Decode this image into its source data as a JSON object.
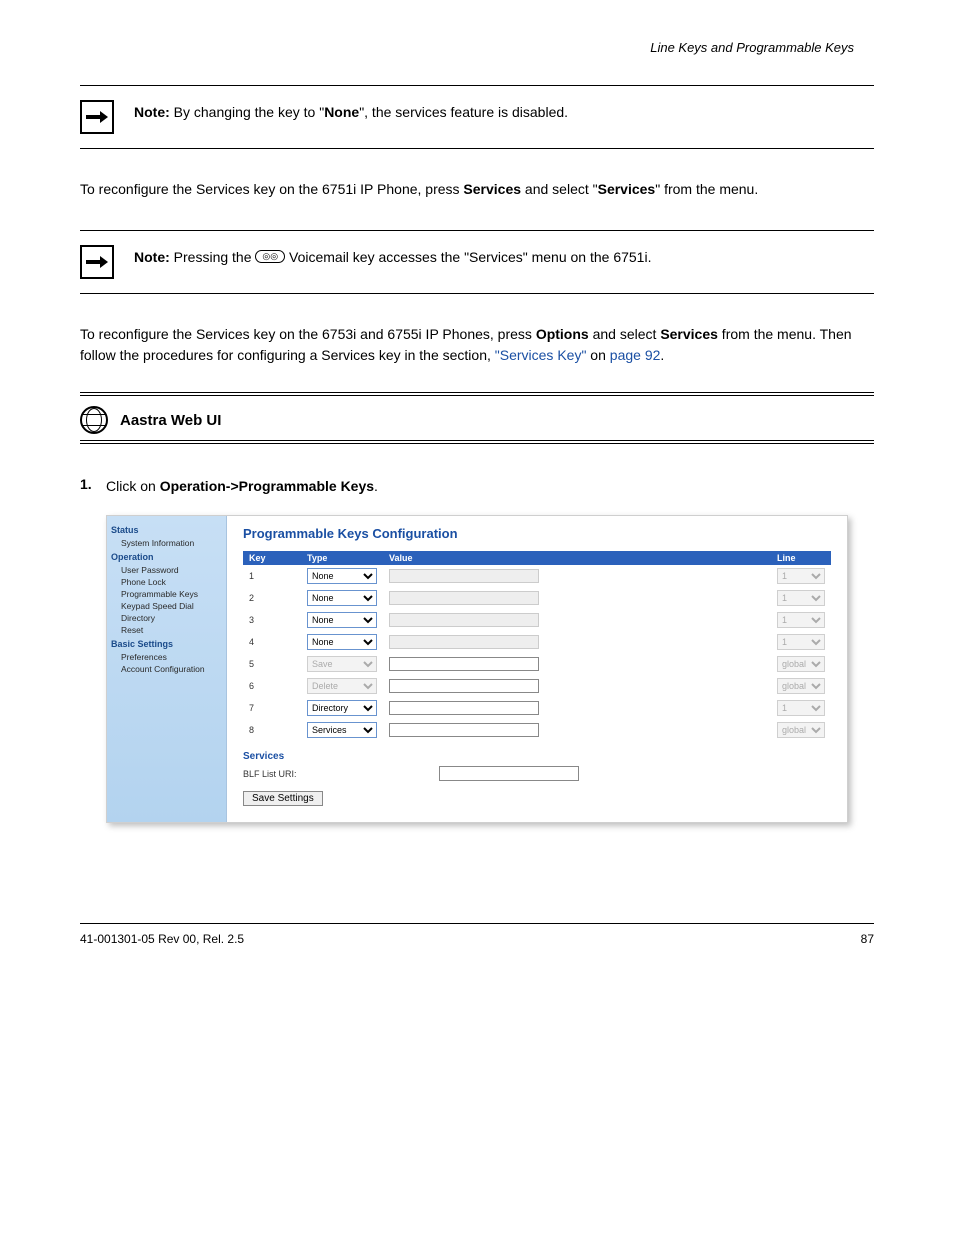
{
  "header": {
    "right": "Line Keys and Programmable Keys"
  },
  "note1": {
    "lead": "Note:",
    "body": " By changing the key to \"",
    "bold": "None",
    "body2": "\", the services feature is disabled."
  },
  "body1": "To reconfigure the Services key on the 6751i IP Phone, press ",
  "body1_bold": "Services",
  "body1_cont": " and select \"",
  "body1_bold2": "Services",
  "body1_cont2": "\" from the menu.",
  "note2": {
    "lead": "Note:",
    "body": " Pressing the ",
    "body_cont": " Voicemail key accesses the \"Services\" menu on the 6751i."
  },
  "body2": "To reconfigure the Services key on the 6753i and 6755i IP Phones, press ",
  "body2_bold": "Options ",
  "body2_cont": "and select ",
  "body2_bold2": "Services",
  "body2_cont2": " from the menu. Then follow the procedures for configuring a Services key in the section, ",
  "body2_link": "\"Services Key\"",
  "body2_cont3": " on ",
  "body2_link2": "page 92",
  "body2_period": ".",
  "webui": {
    "title": "Aastra Web UI"
  },
  "step1": {
    "num": "1.",
    "text_a": "Click on ",
    "bold": "Operation->Programmable Keys",
    "text_b": "."
  },
  "panel": {
    "title": "Programmable Keys Configuration",
    "sidebar": {
      "status": "Status",
      "status_items": [
        "System Information"
      ],
      "operation": "Operation",
      "operation_items": [
        "User Password",
        "Phone Lock",
        "Programmable Keys",
        "Keypad Speed Dial",
        "Directory",
        "Reset"
      ],
      "basic": "Basic Settings",
      "basic_items": [
        "Preferences",
        "Account Configuration"
      ]
    },
    "columns": {
      "key": "Key",
      "type": "Type",
      "value": "Value",
      "line": "Line"
    },
    "rows": [
      {
        "key": "1",
        "type": "None",
        "type_enabled": true,
        "value": "",
        "value_enabled": false,
        "line": "1",
        "line_enabled": false
      },
      {
        "key": "2",
        "type": "None",
        "type_enabled": true,
        "value": "",
        "value_enabled": false,
        "line": "1",
        "line_enabled": false
      },
      {
        "key": "3",
        "type": "None",
        "type_enabled": true,
        "value": "",
        "value_enabled": false,
        "line": "1",
        "line_enabled": false
      },
      {
        "key": "4",
        "type": "None",
        "type_enabled": true,
        "value": "",
        "value_enabled": false,
        "line": "1",
        "line_enabled": false
      },
      {
        "key": "5",
        "type": "Save",
        "type_enabled": false,
        "value": "",
        "value_enabled": true,
        "line": "global",
        "line_enabled": false
      },
      {
        "key": "6",
        "type": "Delete",
        "type_enabled": false,
        "value": "",
        "value_enabled": true,
        "line": "global",
        "line_enabled": false
      },
      {
        "key": "7",
        "type": "Directory",
        "type_enabled": true,
        "value": "",
        "value_enabled": true,
        "line": "1",
        "line_enabled": false
      },
      {
        "key": "8",
        "type": "Services",
        "type_enabled": true,
        "value": "",
        "value_enabled": true,
        "line": "global",
        "line_enabled": false
      }
    ],
    "services_label": "Services",
    "blf_label": "BLF List URI:",
    "blf_value": "",
    "save_btn": "Save Settings"
  },
  "footer": {
    "left": "41-001301-05 Rev 00, Rel. 2.5",
    "right": "87"
  }
}
